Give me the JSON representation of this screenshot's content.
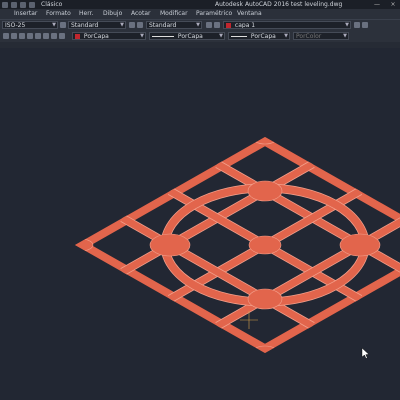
{
  "titlebar": {
    "workspace": "Clásico",
    "app_title": "Autodesk AutoCAD 2016",
    "file": "test leveling.dwg",
    "controls": [
      "—",
      "×"
    ]
  },
  "menu": [
    "Insertar",
    "Formato",
    "Herr.",
    "Dibujo",
    "Acotar",
    "Modificar",
    "Paramétrico",
    "Ventana"
  ],
  "toolbar1": {
    "dimstyle": "ISO-25",
    "textstyle": "Standard",
    "tablestyle": "Standard",
    "layer": "capa 1"
  },
  "toolbar2": {
    "color": "PorCapa",
    "linetype": "PorCapa",
    "lineweight": "PorCapa",
    "plotstyle": "PorColor"
  },
  "colors": {
    "shape": "#e2654c",
    "shape_stroke": "#f3a08c",
    "background": "#222733",
    "layer_swatch": "#c0262e"
  }
}
